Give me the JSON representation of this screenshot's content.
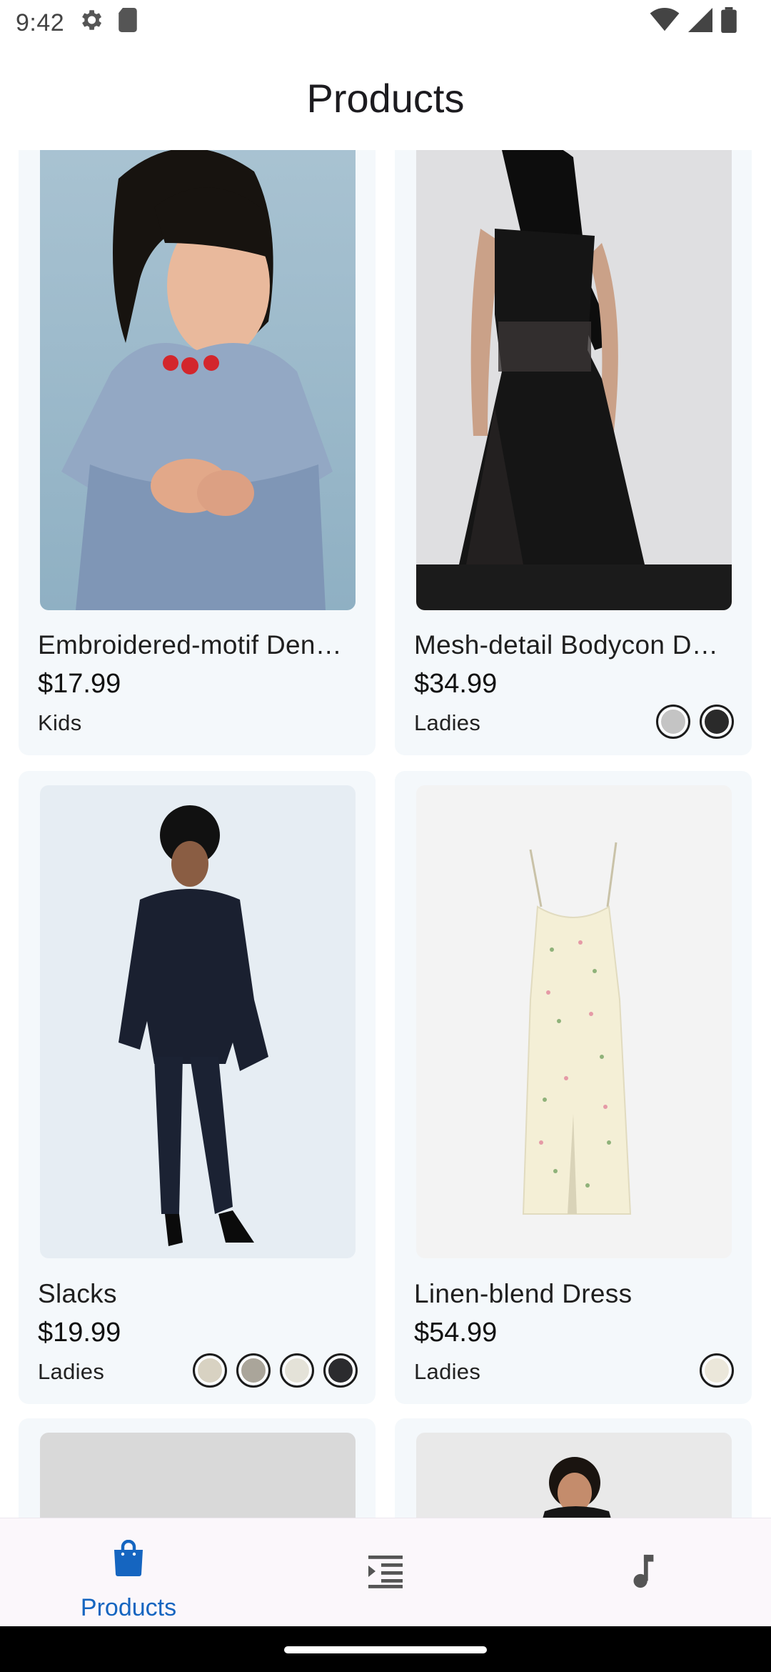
{
  "status_bar": {
    "time": "9:42"
  },
  "app_bar": {
    "title": "Products"
  },
  "products": [
    {
      "name": "Embroidered-motif Den…",
      "price": "$17.99",
      "category": "Kids",
      "swatches": []
    },
    {
      "name": "Mesh-detail Bodycon D…",
      "price": "$34.99",
      "category": "Ladies",
      "swatches": [
        "#c4c4c4",
        "#2a2a2a"
      ]
    },
    {
      "name": "Slacks",
      "price": "$19.99",
      "category": "Ladies",
      "swatches": [
        "#d8d2c2",
        "#aaa59a",
        "#e4e2d8",
        "#2b2b2e"
      ]
    },
    {
      "name": "Linen-blend Dress",
      "price": "$54.99",
      "category": "Ladies",
      "swatches": [
        "#ebe7da"
      ]
    }
  ],
  "bottom_nav": {
    "items": [
      {
        "label": "Products",
        "icon": "shopping-bag-icon",
        "active": true
      },
      {
        "label": "",
        "icon": "list-indent-icon",
        "active": false
      },
      {
        "label": "",
        "icon": "music-note-icon",
        "active": false
      }
    ]
  },
  "colors": {
    "accent": "#1565c0",
    "card_background": "#f4f8fb",
    "nav_background": "#fbf7fb"
  }
}
